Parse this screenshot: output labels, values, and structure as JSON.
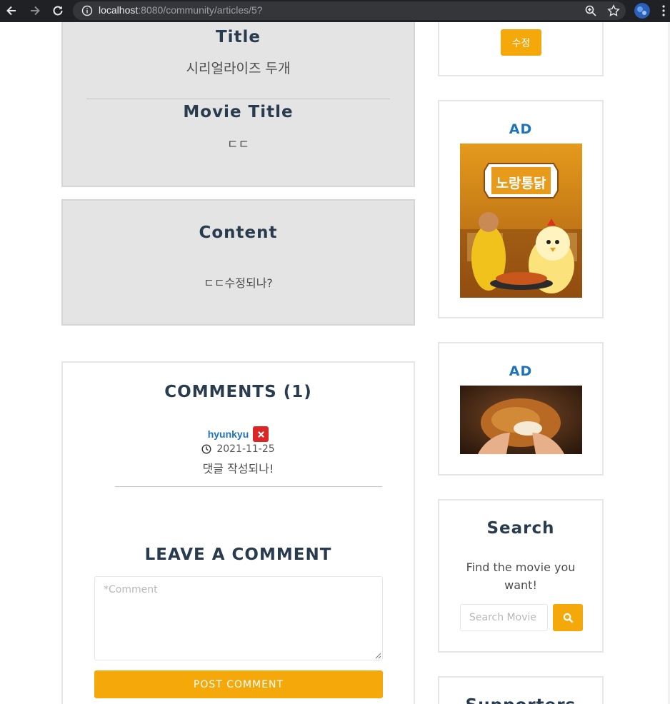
{
  "browser": {
    "url_host": "localhost",
    "url_rest": ":8080/community/articles/5?"
  },
  "article": {
    "title_heading": "Title",
    "title_value": "시리얼라이즈 두개",
    "movie_title_heading": "Movie Title",
    "movie_title_value": "ㄷㄷ",
    "content_heading": "Content",
    "content_value": "ㄷㄷ수정되나?"
  },
  "comments": {
    "heading": "COMMENTS (1)",
    "items": [
      {
        "author": "hyunkyu",
        "date": "2021-11-25",
        "text": "댓글 작성되나!"
      }
    ],
    "leave_heading": "LEAVE A COMMENT",
    "textarea_placeholder": "*Comment",
    "post_label": "POST COMMENT"
  },
  "sidebar": {
    "edit_label": "수정",
    "ads": [
      {
        "label": "AD",
        "image": "노랑통닭"
      },
      {
        "label": "AD"
      }
    ],
    "search": {
      "heading": "Search",
      "description": "Find the movie you want!",
      "placeholder": "Search Movie"
    },
    "supporters_heading": "Supporters"
  },
  "colors": {
    "accent": "#f4a80a",
    "link": "#1e73be",
    "danger": "#dc2626",
    "heading": "#283b4f",
    "card_gray": "#e4e4e4"
  },
  "icons": [
    "back-arrow-icon",
    "forward-arrow-icon",
    "reload-icon",
    "info-icon",
    "zoom-icon",
    "star-icon",
    "profile-avatar-icon",
    "kebab-menu-icon",
    "close-x-icon",
    "clock-icon",
    "search-icon"
  ]
}
